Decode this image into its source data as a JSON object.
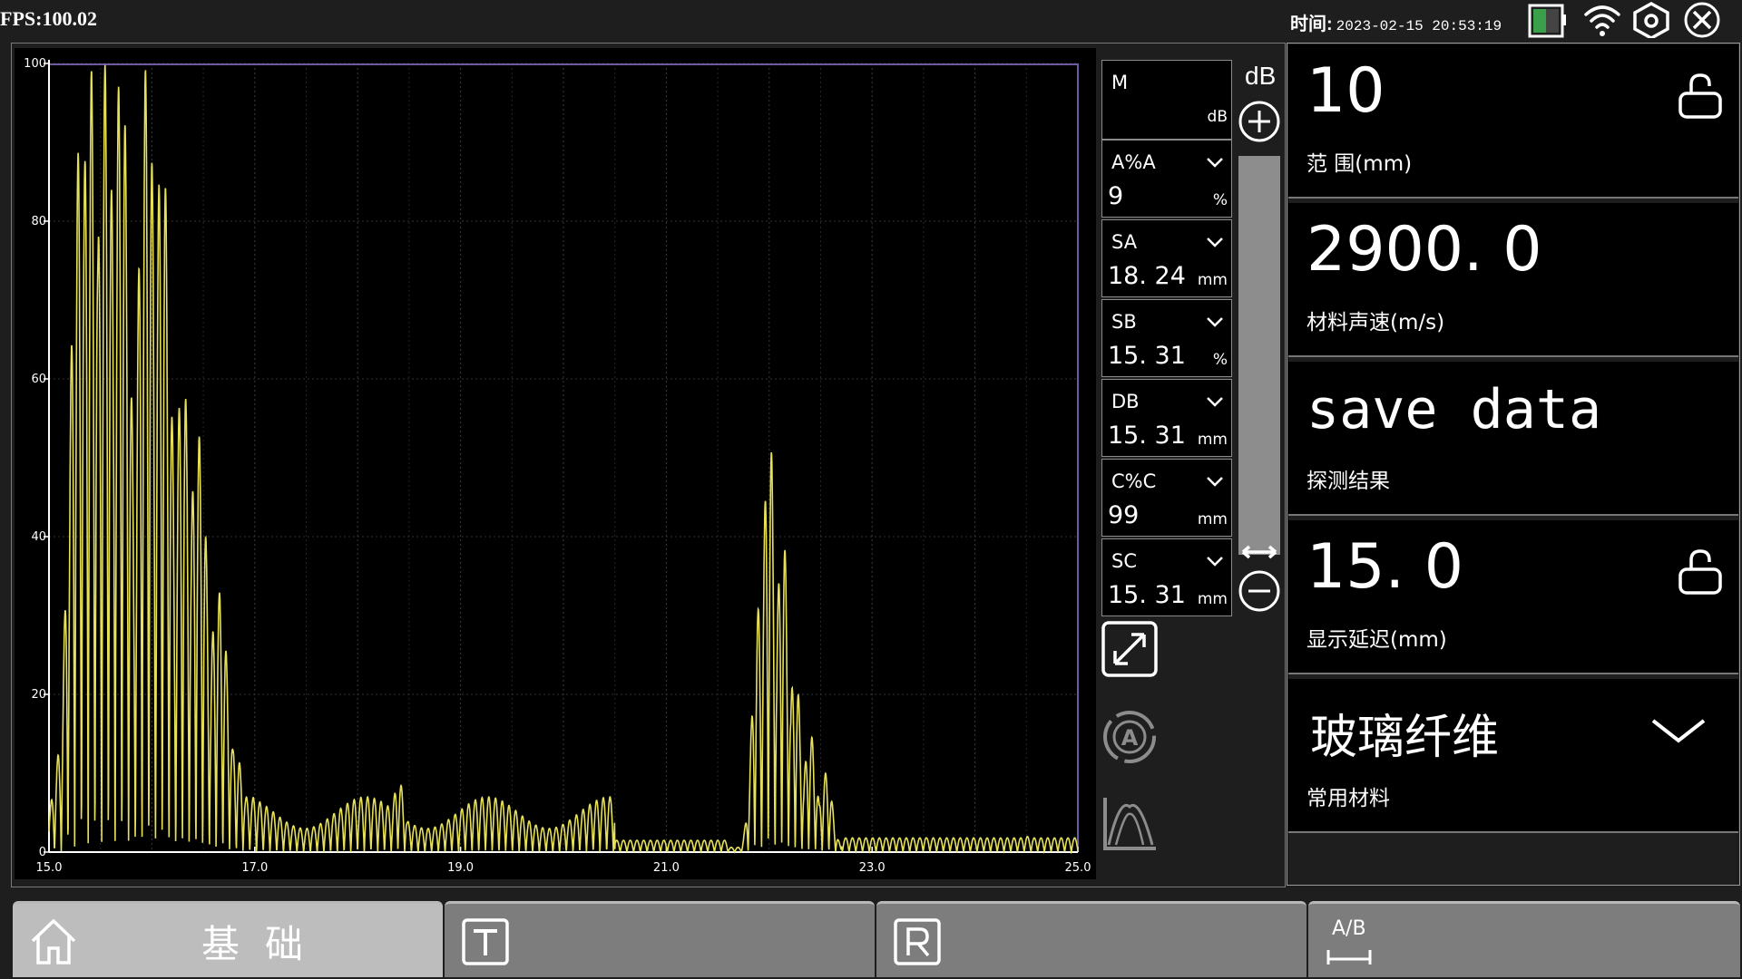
{
  "status_bar": {
    "fps": "FPS:100.02",
    "time_label": "时间:",
    "time_value": "2023-02-15 20:53:19",
    "icons": [
      "battery-icon",
      "wifi-icon",
      "settings-hex-icon",
      "close-icon"
    ]
  },
  "measurements": {
    "mode": "M",
    "mode_unit": "dB",
    "items": [
      {
        "label": "A%A",
        "value": "9",
        "unit": "%"
      },
      {
        "label": "SA",
        "value": "18. 24",
        "unit": "mm"
      },
      {
        "label": "SB",
        "value": "15. 31",
        "unit": "%"
      },
      {
        "label": "DB",
        "value": "15. 31",
        "unit": "mm"
      },
      {
        "label": "C%C",
        "value": "99",
        "unit": "mm"
      },
      {
        "label": "SC",
        "value": "15. 31",
        "unit": "mm"
      }
    ]
  },
  "gain": {
    "label": "dB"
  },
  "params": [
    {
      "value": "10",
      "label": "范 围(mm)",
      "locked": false
    },
    {
      "value": "2900. 0",
      "label": "材料声速(m/s)"
    },
    {
      "value": "save data",
      "label": "探测结果"
    },
    {
      "value": "15. 0",
      "label": "显示延迟(mm)",
      "locked": false
    },
    {
      "value": "玻璃纤维",
      "label": "常用材料"
    }
  ],
  "tabs": [
    {
      "label": "基础",
      "icon": "home-icon",
      "active": true
    },
    {
      "label": "",
      "icon": "t-box-icon"
    },
    {
      "label": "",
      "icon": "r-box-icon"
    },
    {
      "label": "A/B",
      "icon": "ab-range-icon"
    }
  ],
  "side_icons": [
    "expand-icon",
    "auto-a-icon",
    "envelope-icon"
  ],
  "colors": {
    "trace": "#e6e05a",
    "background": "#000000",
    "panel": "#1e1e1e",
    "gate": "#6e5aa0"
  },
  "chart_data": {
    "type": "line",
    "title": "",
    "xlabel": "",
    "ylabel": "",
    "xlim": [
      15.0,
      25.0
    ],
    "ylim": [
      0,
      100
    ],
    "x_ticks": [
      "15.0",
      "17.0",
      "19.0",
      "21.0",
      "23.0",
      "25.0"
    ],
    "y_ticks": [
      "0",
      "20",
      "40",
      "60",
      "80",
      "100"
    ],
    "grid": true,
    "series": [
      {
        "peaks": [
          {
            "x": 15.15,
            "y": 15
          },
          {
            "x": 15.3,
            "y": 90
          },
          {
            "x": 15.4,
            "y": 100
          },
          {
            "x": 15.55,
            "y": 100
          },
          {
            "x": 15.7,
            "y": 100
          },
          {
            "x": 15.95,
            "y": 100
          },
          {
            "x": 16.1,
            "y": 89
          },
          {
            "x": 16.3,
            "y": 60
          },
          {
            "x": 16.45,
            "y": 53
          },
          {
            "x": 16.65,
            "y": 33
          },
          {
            "x": 16.8,
            "y": 13
          },
          {
            "x": 17.0,
            "y": 7
          },
          {
            "x": 18.4,
            "y": 9
          },
          {
            "x": 19.3,
            "y": 6
          },
          {
            "x": 21.9,
            "y": 31
          },
          {
            "x": 22.0,
            "y": 54
          },
          {
            "x": 22.13,
            "y": 41
          },
          {
            "x": 22.25,
            "y": 23
          },
          {
            "x": 22.4,
            "y": 15
          },
          {
            "x": 22.55,
            "y": 10
          },
          {
            "x": 23.5,
            "y": 2
          },
          {
            "x": 24.5,
            "y": 2
          }
        ]
      }
    ]
  }
}
